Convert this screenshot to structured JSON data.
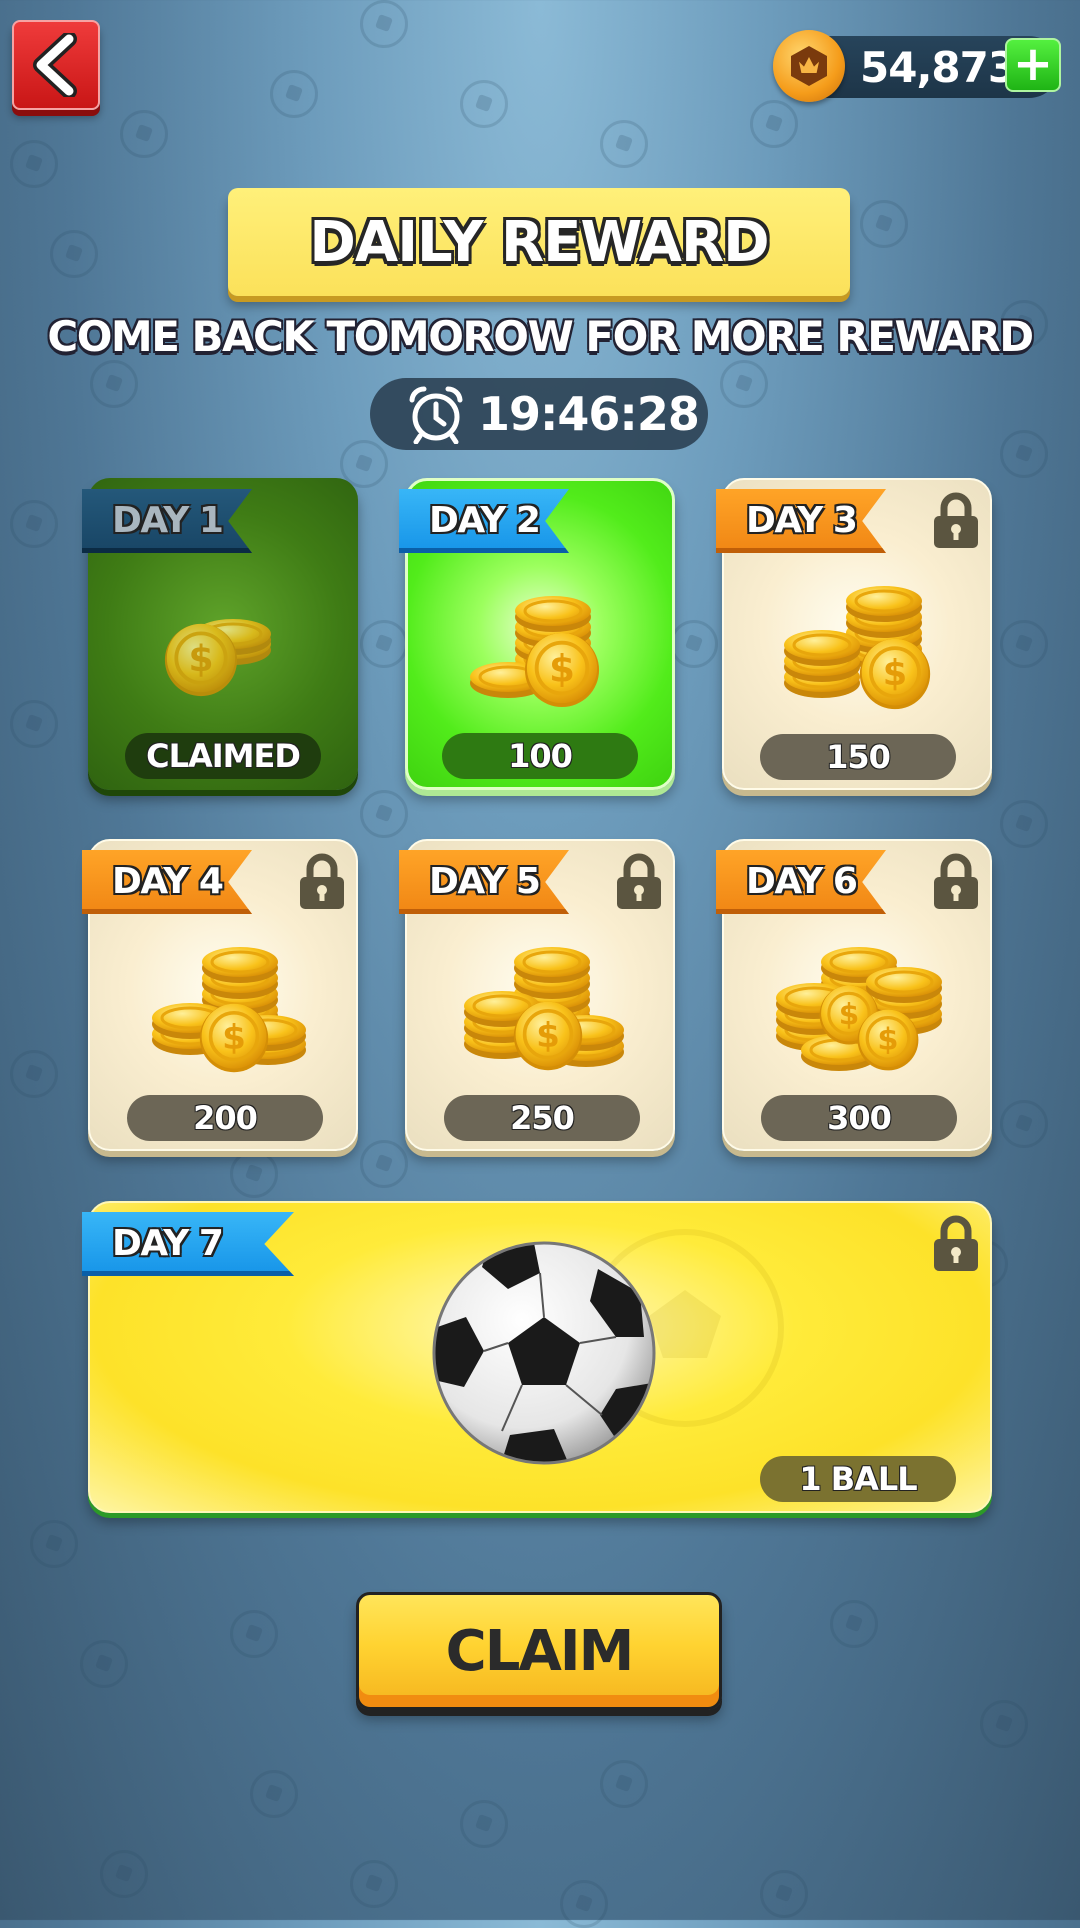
{
  "header": {
    "back_label": "back",
    "coins": "54,873",
    "plus_label": "+"
  },
  "title": "DAILY REWARD",
  "subtitle": "COME BACK TOMOROW FOR MORE REWARD",
  "timer": "19:46:28",
  "days": [
    {
      "label": "DAY 1",
      "value": "CLAIMED",
      "state": "claimed"
    },
    {
      "label": "DAY 2",
      "value": "100",
      "state": "current"
    },
    {
      "label": "DAY 3",
      "value": "150",
      "state": "locked"
    },
    {
      "label": "DAY 4",
      "value": "200",
      "state": "locked"
    },
    {
      "label": "DAY 5",
      "value": "250",
      "state": "locked"
    },
    {
      "label": "DAY 6",
      "value": "300",
      "state": "locked"
    },
    {
      "label": "DAY 7",
      "value": "1 BALL",
      "state": "locked"
    }
  ],
  "claim_label": "CLAIM",
  "colors": {
    "claimed": "#3f7c15",
    "current": "#52ec1b",
    "locked": "#faeed0",
    "day7": "#ffeb3a",
    "ribbon_orange": "#f08614",
    "ribbon_blue": "#1694e8",
    "claim_button": "#ffd331"
  },
  "icons": [
    "back-arrow-icon",
    "crown-coin-icon",
    "plus-icon",
    "alarm-clock-icon",
    "padlock-icon",
    "gold-coin-stack-icon",
    "soccer-ball-icon"
  ]
}
